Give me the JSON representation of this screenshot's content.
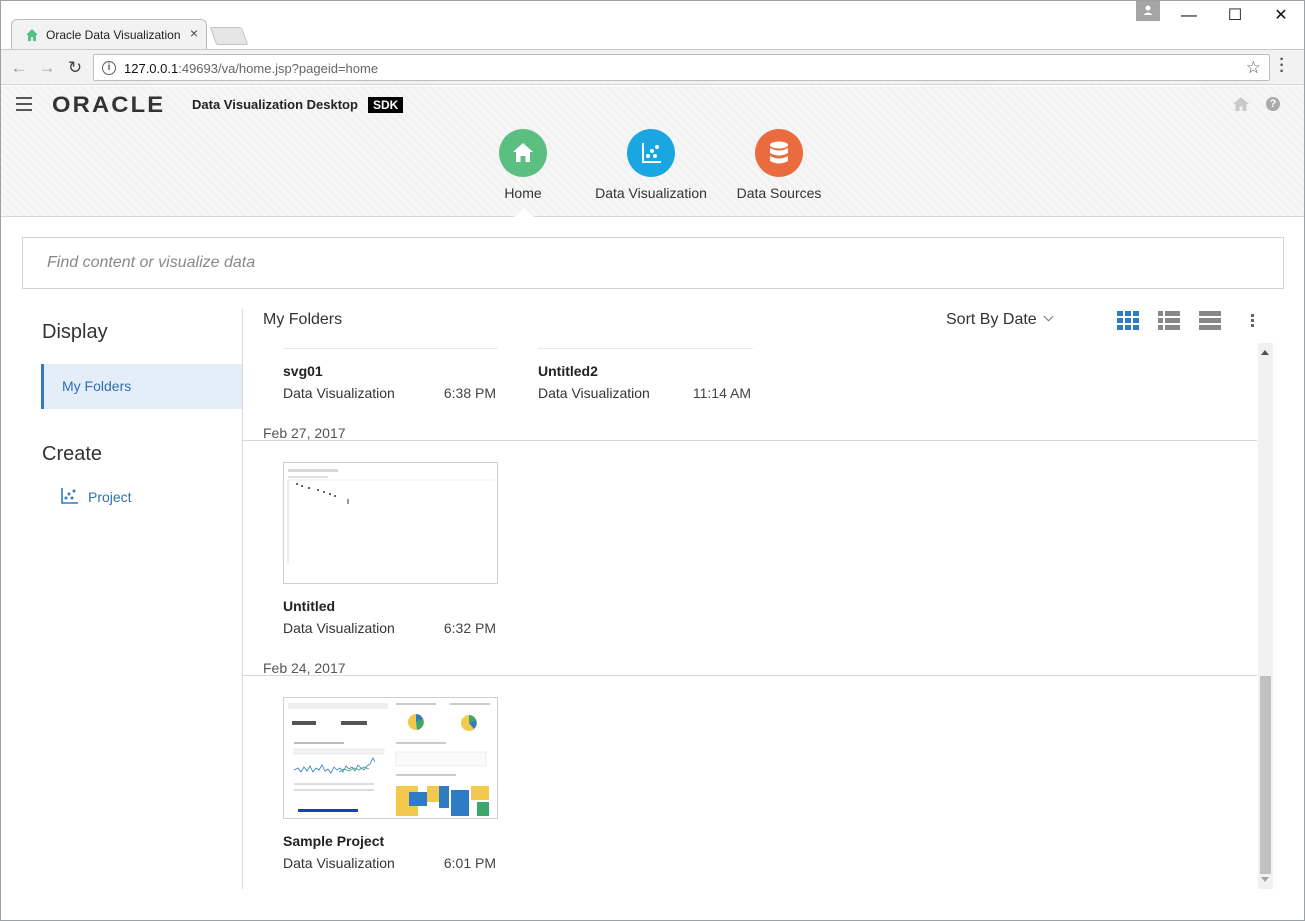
{
  "browser": {
    "tab_title": "Oracle Data Visualization",
    "tab_close": "×",
    "url_host": "127.0.0.1",
    "url_rest": ":49693/va/home.jsp?pageid=home",
    "window_controls": {
      "minimize": "—",
      "maximize": "☐",
      "close": "✕"
    },
    "nav": {
      "back": "←",
      "forward": "→",
      "reload": "↻"
    },
    "star": "☆"
  },
  "header": {
    "logo": "ORACLE",
    "app_name": "Data Visualization Desktop",
    "badge": "SDK",
    "help": "?",
    "nav_items": [
      {
        "label": "Home",
        "icon": "home-icon",
        "color": "#5bbf82"
      },
      {
        "label": "Data Visualization",
        "icon": "scatter-chart-icon",
        "color": "#1aa6e0"
      },
      {
        "label": "Data Sources",
        "icon": "database-icon",
        "color": "#ea6b3d"
      }
    ]
  },
  "search": {
    "placeholder": "Find content or visualize data"
  },
  "sidebar": {
    "display_heading": "Display",
    "display_items": [
      {
        "label": "My Folders",
        "selected": true
      }
    ],
    "create_heading": "Create",
    "create_items": [
      {
        "label": "Project",
        "icon": "project-chart-icon"
      }
    ]
  },
  "main": {
    "title": "My Folders",
    "sort_label": "Sort By Date",
    "view_modes": [
      "grid-view-icon",
      "list-detail-view-icon",
      "list-view-icon"
    ],
    "active_view": "grid-view-icon",
    "groups": [
      {
        "date": "",
        "items": [
          {
            "name": "svg01",
            "type": "Data Visualization",
            "time": "6:38 PM"
          },
          {
            "name": "Untitled2",
            "type": "Data Visualization",
            "time": "11:14 AM"
          }
        ]
      },
      {
        "date": "Feb 27, 2017",
        "items": [
          {
            "name": "Untitled",
            "type": "Data Visualization",
            "time": "6:32 PM"
          }
        ]
      },
      {
        "date": "Feb 24, 2017",
        "items": [
          {
            "name": "Sample Project",
            "type": "Data Visualization",
            "time": "6:01 PM"
          }
        ]
      }
    ]
  },
  "colors": {
    "accent": "#2f7cc4",
    "home": "#5bbf82",
    "dataviz": "#1aa6e0",
    "datasources": "#ea6b3d"
  }
}
